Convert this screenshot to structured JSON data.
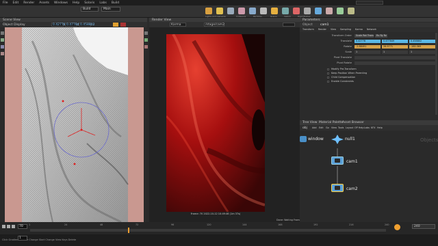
{
  "menubar": {
    "items": [
      "File",
      "Edit",
      "Render",
      "Assets",
      "Windows",
      "Help",
      "Solaris",
      "Labs",
      "Build"
    ],
    "desktop": "Build",
    "take": "Main",
    "search_placeholder": "Search"
  },
  "shelf": {
    "labels": [
      "Lights and Cameras",
      "Collisions",
      "Particles",
      "Grains",
      "Vellum",
      "Rigid Bodies"
    ]
  },
  "viewport": {
    "tab": "Scene View",
    "view_label": "Object Display",
    "camera": "persp1",
    "frame": "0"
  },
  "render_view": {
    "tab": "Render View",
    "renderer": "Karma",
    "camera": "/stage/cam2",
    "caption": "Frame: 70  2022-10-12 10:49:46  (1m 37s)",
    "status": "Done: Waiting Frames"
  },
  "params": {
    "tab": "Parameters",
    "node_type": "Object",
    "node_name": "cam1",
    "subtabs": [
      "Transform",
      "Render",
      "View",
      "Sampling",
      "Karma",
      "Network"
    ],
    "transform_order_label": "Transform Order",
    "transform_order": "Scale Rot Trans",
    "rotate_order": "Rx Ry Rz",
    "translate_label": "Translate",
    "translate": [
      "0.42778",
      "0.477849",
      "0.458802"
    ],
    "rotate_label": "Rotate",
    "rotate": [
      "-1.88491",
      "26.9771",
      "-180.369"
    ],
    "scale_label": "Scale",
    "scale": [
      "1",
      "1",
      "1"
    ],
    "pivot_translate_label": "Pivot Translate",
    "pivot_rotate_label": "Pivot Rotate",
    "toggles": [
      "Modify Pre-Transform",
      "Keep Position When Parenting",
      "Child Compensation",
      "Enable Constraints"
    ]
  },
  "network": {
    "tabs": [
      "Tree View",
      "Material Palette",
      "Asset Browser"
    ],
    "path": "obj",
    "menu": [
      "Add",
      "Edit",
      "Go",
      "View",
      "Tools",
      "Layout",
      "OP Help",
      "Labs",
      "KFX",
      "Help"
    ],
    "context_label": "Objects",
    "nodes": [
      {
        "name": "window"
      },
      {
        "name": "null1"
      },
      {
        "name": "cam1"
      },
      {
        "name": "cam2"
      }
    ]
  },
  "timeline": {
    "frame": "70",
    "ticks": [
      "1",
      "24",
      "48",
      "72",
      "96",
      "120",
      "144",
      "168",
      "192",
      "216",
      "240"
    ],
    "end": "240",
    "start": "1",
    "status": "Click Gradient Handle Change Start Change View Keys Delete"
  },
  "colors": {
    "accent": "#f0a030",
    "render_red": "#b81010",
    "node_blue": "#5aa0d8"
  }
}
